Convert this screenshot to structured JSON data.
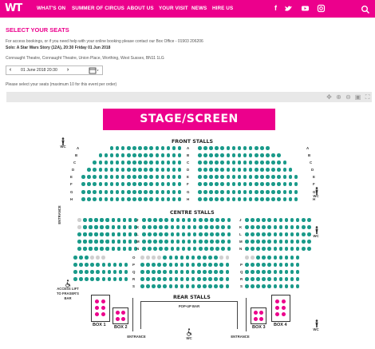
{
  "header": {
    "logo": "WT",
    "nav": [
      "WHAT'S ON",
      "SUMMER OF CIRCUS",
      "ABOUT US",
      "YOUR VISIT",
      "NEWS",
      "HIRE US"
    ],
    "social_icons": [
      "facebook-icon",
      "twitter-icon",
      "youtube-icon",
      "instagram-icon"
    ],
    "search_icon": "search-icon"
  },
  "page": {
    "title": "SELECT YOUR SEATS",
    "access_note": "For access bookings, or if you need help with your online booking please contact our Box Office - 01903 206206",
    "event_line": "Solo: A Star Wars Story (12A), 20:30 Friday 01 Jun 2018",
    "venue_line": "Connaught Theatre, Connaught Theatre, Union Place, Worthing, West Sussex, BN11 1LG",
    "date_value": "01 June 2018 20:30",
    "prompt": "Please select your seats (maximum 10 for this event per order)"
  },
  "plan": {
    "stage_label": "STAGE/SCREEN",
    "front_stalls": "FRONT STALLS",
    "centre_stalls": "CENTRE STALLS",
    "rear_stalls": "REAR STALLS",
    "front_rows": [
      "A",
      "B",
      "C",
      "D",
      "E",
      "F",
      "G",
      "H"
    ],
    "centre_rows": [
      "J",
      "K",
      "L",
      "M",
      "N"
    ],
    "rear_rows": [
      "P",
      "Q",
      "R",
      "S"
    ],
    "wc": "WC",
    "entrance": "ENTRANCE",
    "access_lift": "ACCESS LIFT TO FRASER'S BAR",
    "popup_bar": "POP-UP BAR",
    "boxes": [
      "BOX 1",
      "BOX 2",
      "BOX 3",
      "BOX 4"
    ],
    "colors": {
      "available": "#1a9a8a",
      "unavailable": "#cfcfcf",
      "box_seat": "#ec008c",
      "brand": "#ec008c"
    }
  }
}
